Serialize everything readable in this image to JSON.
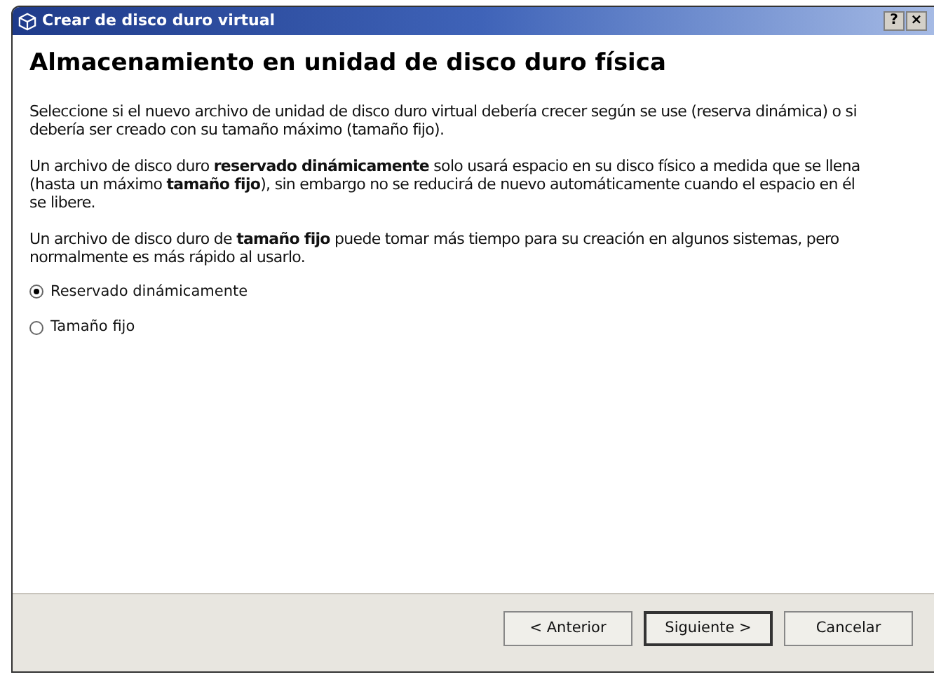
{
  "window": {
    "title": "Crear de disco duro virtual",
    "controls": [
      "?",
      "×"
    ]
  },
  "heading": "Almacenamiento en unidad de disco duro física",
  "paragraphs": [
    "Seleccione si el nuevo archivo de unidad de disco duro virtual debería crecer según se use (reserva dinámica) o si debería ser creado con su tamaño máximo (tamaño fijo).",
    "Un archivo de disco duro **reservado dinámicamente** solo usará espacio en su disco físico a medida que se llena (hasta un máximo **tamaño fijo**), sin embargo no se reducirá de nuevo automáticamente cuando el espacio en él se libere.",
    "Un archivo de disco duro de **tamaño fijo** puede tomar más tiempo para su creación en algunos sistemas, pero normalmente es más rápido al usarlo."
  ],
  "options": [
    {
      "label": "Reservado dinámicamente",
      "selected": true
    },
    {
      "label": "Tamaño fijo",
      "selected": false
    }
  ],
  "buttons": [
    {
      "label": "< Anterior",
      "default": false
    },
    {
      "label": "Siguiente >",
      "default": true
    },
    {
      "label": "Cancelar",
      "default": false
    }
  ]
}
